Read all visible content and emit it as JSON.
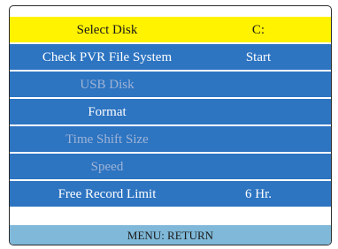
{
  "menu": {
    "items": [
      {
        "label": "Select Disk",
        "value": "C:"
      },
      {
        "label": "Check  PVR File System",
        "value": "Start"
      },
      {
        "label": "USB Disk",
        "value": ""
      },
      {
        "label": "Format",
        "value": ""
      },
      {
        "label": "Time Shift Size",
        "value": ""
      },
      {
        "label": "Speed",
        "value": ""
      },
      {
        "label": "Free Record  Limit",
        "value": "6 Hr."
      }
    ]
  },
  "footer": {
    "hint": "MENU: RETURN"
  },
  "colors": {
    "row_background": "#2d74c1",
    "selected_background": "#fff300",
    "disabled_text": "#9fb4d6",
    "footer_background": "#7fb8d8"
  }
}
